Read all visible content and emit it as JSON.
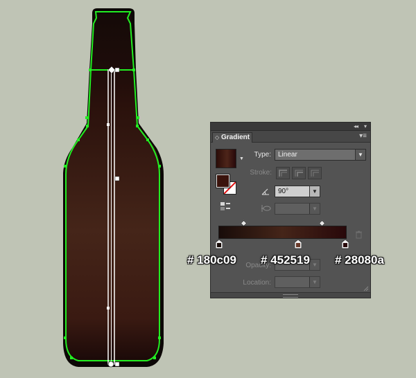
{
  "panel": {
    "title": "Gradient",
    "type_label": "Type:",
    "type_value": "Linear",
    "stroke_label": "Stroke:",
    "angle_value": "90°",
    "aspect_value": "",
    "opacity_label": "Opacity:",
    "location_label": "Location:"
  },
  "gradient": {
    "stops": [
      "#180c09",
      "#452519",
      "#28080a"
    ]
  },
  "annotations": {
    "stop1": "# 180c09",
    "stop2": "# 452519",
    "stop3": "# 28080a"
  },
  "colors": {
    "artboard_bg": "#bfc4b5",
    "selection_green": "#22ff22",
    "panel_bg": "#535353"
  },
  "icons": [
    "bottle-artwork",
    "gradient-annotator",
    "collapse-icon",
    "close-icon",
    "panel-menu-icon",
    "angle-icon",
    "aspect-ratio-icon",
    "trash-icon",
    "gradient-type-icon"
  ]
}
